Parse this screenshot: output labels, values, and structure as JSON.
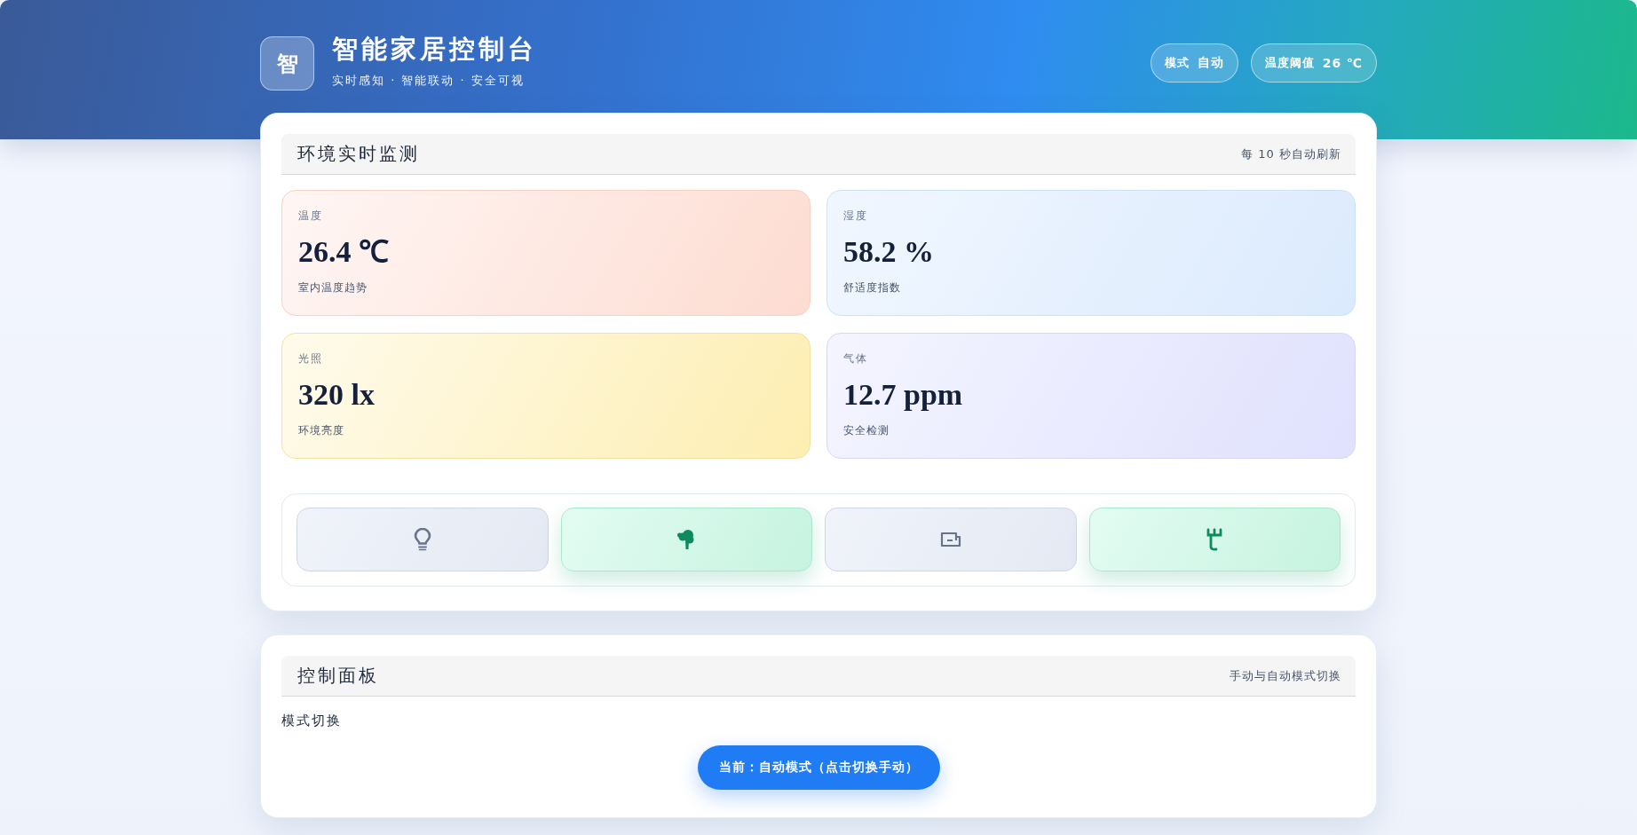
{
  "header": {
    "logo": "智",
    "title": "智能家居控制台",
    "subtitle": "实时感知 · 智能联动 · 安全可视",
    "badges": [
      {
        "label": "模式",
        "value": "自动"
      },
      {
        "label": "温度阈值",
        "value": "26 ℃"
      }
    ]
  },
  "monitor": {
    "title": "环境实时监测",
    "note": "每 10 秒自动刷新",
    "sensors": [
      {
        "kind": "temperature",
        "label": "温度",
        "value": "26.4 ℃",
        "caption": "室内温度趋势"
      },
      {
        "kind": "humidity",
        "label": "湿度",
        "value": "58.2 %",
        "caption": "舒适度指数"
      },
      {
        "kind": "light",
        "label": "光照",
        "value": "320 lx",
        "caption": "环境亮度"
      },
      {
        "kind": "gas",
        "label": "气体",
        "value": "12.7 ppm",
        "caption": "安全检测"
      }
    ],
    "devices": [
      {
        "kind": "bulb",
        "on": false
      },
      {
        "kind": "tree",
        "on": true
      },
      {
        "kind": "wallet",
        "on": false
      },
      {
        "kind": "plug",
        "on": true
      }
    ]
  },
  "control": {
    "title": "控制面板",
    "note": "手动与自动模式切换",
    "section_label": "模式切换",
    "mode_button": "当前：自动模式（点击切换手动）"
  }
}
